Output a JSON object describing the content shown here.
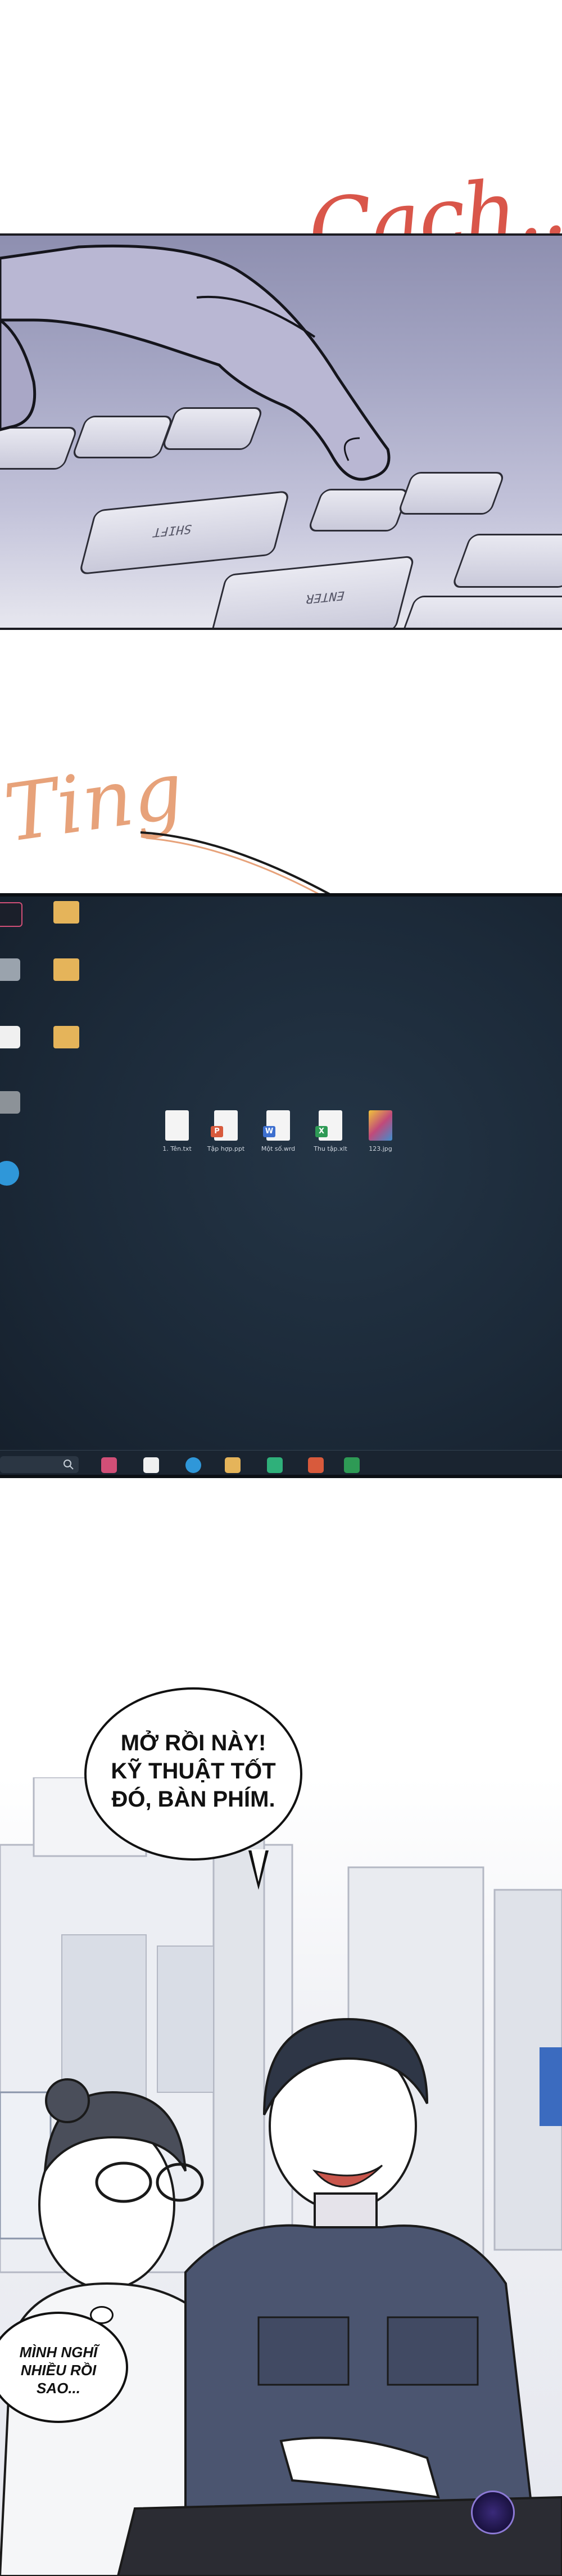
{
  "sfx": {
    "click": "Cạch...",
    "ding": "Ting"
  },
  "keyboard": {
    "shift_label": "SHIFT",
    "enter_label": "ENTER"
  },
  "desktop": {
    "files": [
      {
        "label": "1. Tên.txt",
        "type": "txt",
        "color": "#e9eef5"
      },
      {
        "label": "Tập hợp.ppt",
        "type": "ppt",
        "color": "#d85a3c"
      },
      {
        "label": "Một số.wrd",
        "type": "wrd",
        "color": "#3d6fcf"
      },
      {
        "label": "Thu tập.xlt",
        "type": "xlt",
        "color": "#2e9a55"
      },
      {
        "label": "123.jpg",
        "type": "jpg",
        "color": "#c04a7a"
      }
    ]
  },
  "dialogue": {
    "friend_line": "MỞ RỒI NÀY! KỸ THUẬT TỐT ĐÓ, BÀN PHÍM.",
    "inner_thought": "MÌNH NGHĨ NHIỀU RỒI SAO..."
  },
  "colors": {
    "sfx_click": "#d9564a",
    "sfx_ding": "#e7a27a",
    "desktop_bg": "#1c2a39"
  }
}
